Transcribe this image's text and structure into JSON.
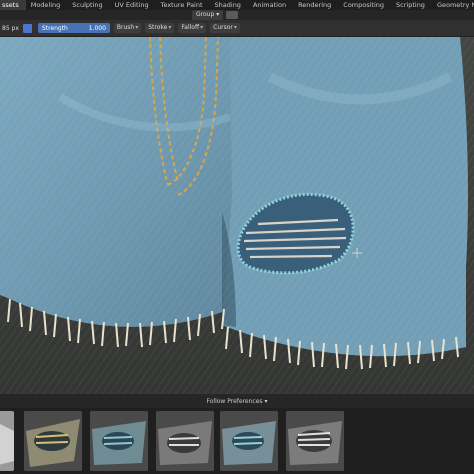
{
  "workspace_tabs": [
    "ssets",
    "Modeling",
    "Sculpting",
    "UV Editing",
    "Texture Paint",
    "Shading",
    "Animation",
    "Rendering",
    "Compositing",
    "Scripting",
    "Geometry Nodes"
  ],
  "active_tab_index": 0,
  "header": {
    "group_label": "Group"
  },
  "toolbar": {
    "radius": "85 px",
    "strength_label": "Strength",
    "strength_value": "1.000",
    "brush": "Brush",
    "stroke": "Stroke",
    "falloff": "Falloff",
    "cursor": "Cursor"
  },
  "preferences_bar": {
    "label": "Follow Preferences"
  },
  "asset_thumbnails": [
    {
      "name": "patch-silver",
      "colors": [
        "#c8c8c8",
        "#777"
      ]
    },
    {
      "name": "patch-gold",
      "colors": [
        "#d8c070",
        "#6f5a2a"
      ]
    },
    {
      "name": "patch-blue",
      "colors": [
        "#8fc9d6",
        "#3b6c7b"
      ]
    },
    {
      "name": "patch-white",
      "colors": [
        "#dedede",
        "#7a7a7a"
      ]
    },
    {
      "name": "patch-blue-2",
      "colors": [
        "#95d0dc",
        "#3f6f80"
      ]
    },
    {
      "name": "patch-stripes",
      "colors": [
        "#e0e0e0",
        "#6f6f6f"
      ]
    }
  ]
}
